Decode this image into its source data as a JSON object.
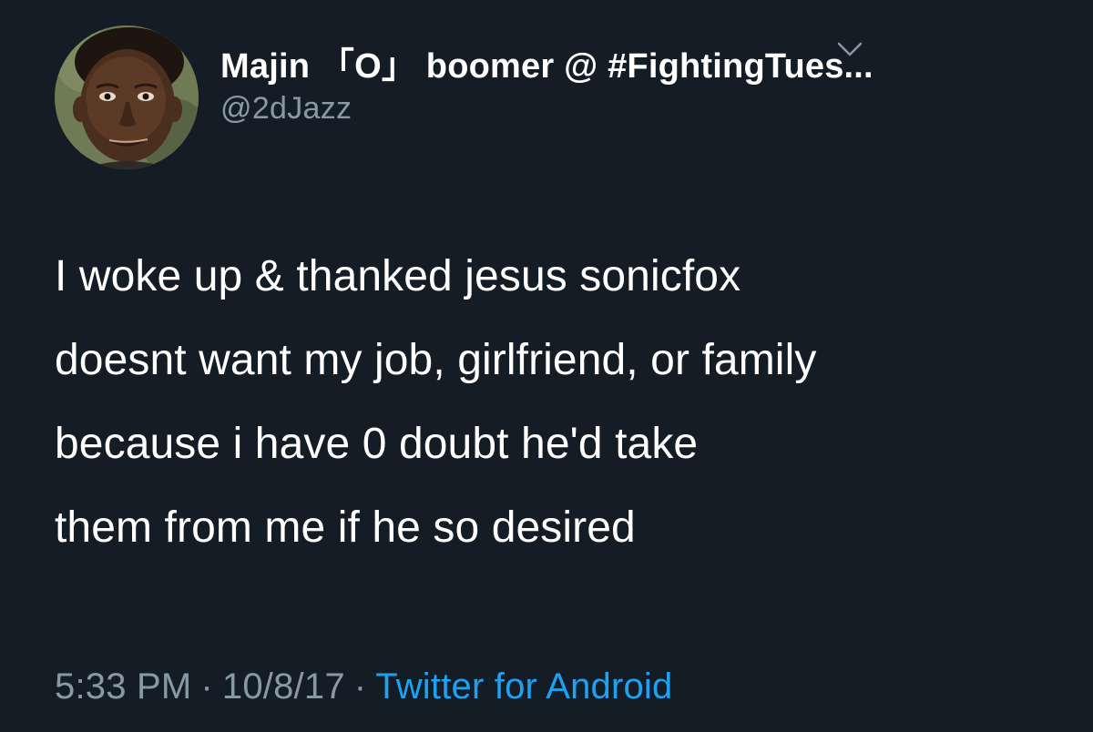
{
  "tweet": {
    "author": {
      "display_name": "Majin 「O」 boomer @ #FightingTues...",
      "handle": "@2dJazz",
      "avatar_icon": "profile-photo"
    },
    "more_menu_icon": "chevron-down-icon",
    "text_lines": [
      "I woke up & thanked jesus sonicfox",
      "doesnt want my job, girlfriend, or family",
      "because i have 0 doubt he'd take",
      "them from me if he so desired"
    ],
    "meta": {
      "time": "5:33 PM",
      "separator": "·",
      "date": "10/8/17",
      "source": "Twitter for Android"
    }
  },
  "colors": {
    "background": "#141d26",
    "primary_text": "#ffffff",
    "secondary_text": "#8899a6",
    "link": "#1da1f2"
  }
}
